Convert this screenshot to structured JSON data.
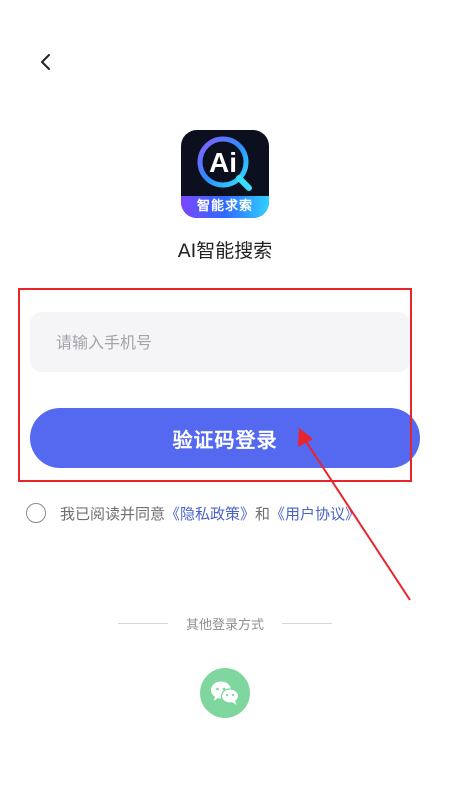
{
  "app": {
    "name": "AI智能搜索",
    "logo_text": "Ai",
    "logo_banner": "智能求索"
  },
  "login": {
    "phone_placeholder": "请输入手机号",
    "phone_value": "",
    "button_label": "验证码登录"
  },
  "agreement": {
    "prefix": "我已阅读并同意",
    "privacy_link": "《隐私政策》",
    "joiner": "和",
    "user_link": "《用户协议》",
    "checked": false
  },
  "other_login": {
    "label": "其他登录方式",
    "options": [
      "wechat-icon"
    ]
  },
  "colors": {
    "primary": "#5469f0",
    "link": "#4b63c9",
    "wechat": "#7fd69e",
    "annotation": "#e8252a"
  }
}
